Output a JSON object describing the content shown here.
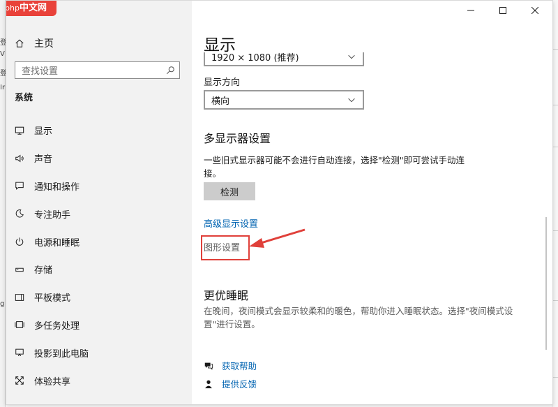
{
  "logo": {
    "brand": "php",
    "text": "中文网"
  },
  "bg_left_fragments": [
    "登",
    "V",
    "登",
    "Ir",
    "g"
  ],
  "sidebar": {
    "home": "主页",
    "search_placeholder": "查找设置",
    "section": "系统",
    "items": [
      {
        "label": "显示",
        "icon": "monitor-icon"
      },
      {
        "label": "声音",
        "icon": "speaker-icon"
      },
      {
        "label": "通知和操作",
        "icon": "notification-icon"
      },
      {
        "label": "专注助手",
        "icon": "moon-icon"
      },
      {
        "label": "电源和睡眠",
        "icon": "power-icon"
      },
      {
        "label": "存储",
        "icon": "storage-icon"
      },
      {
        "label": "平板模式",
        "icon": "tablet-icon"
      },
      {
        "label": "多任务处理",
        "icon": "multitask-icon"
      },
      {
        "label": "投影到此电脑",
        "icon": "project-icon"
      },
      {
        "label": "体验共享",
        "icon": "share-icon"
      }
    ]
  },
  "main": {
    "title": "显示",
    "resolution_value": "1920 × 1080 (推荐)",
    "orientation_label": "显示方向",
    "orientation_value": "横向",
    "multi_display_heading": "多显示器设置",
    "multi_display_desc": "一些旧式显示器可能不会进行自动连接，选择\"检测\"即可尝试手动连接。",
    "detect_button": "检测",
    "advanced_link": "高级显示设置",
    "graphics_link": "图形设置",
    "sleep_heading": "更优睡眠",
    "sleep_desc": "在晚间，夜间模式会显示较柔和的暖色，帮助你进入睡眠状态。选择\"夜间模式设置\"进行设置。",
    "get_help": "获取帮助",
    "feedback": "提供反馈"
  },
  "colors": {
    "accent": "#0063b1",
    "highlight": "#e0403a",
    "sidebar_bg": "#f2f2f2",
    "logo_bg": "#e9423a"
  }
}
